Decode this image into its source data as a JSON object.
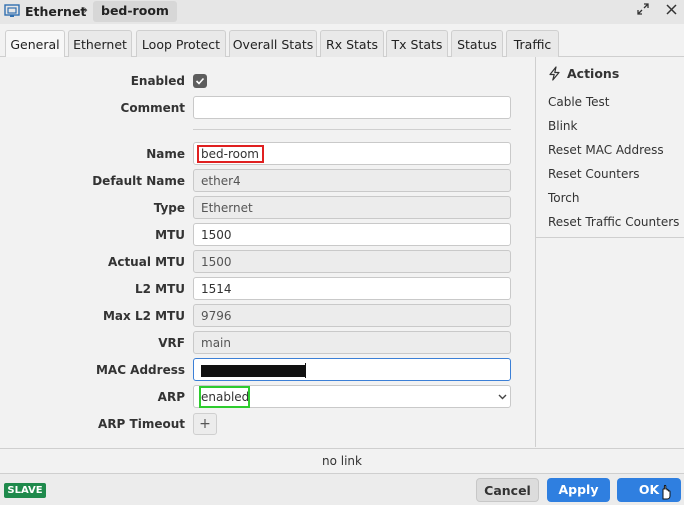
{
  "titlebar": {
    "section": "Ethernet",
    "separator": "›",
    "item": "bed-room",
    "icons": [
      "ethernet-port-icon",
      "expand-icon",
      "close-icon"
    ]
  },
  "tabs": [
    {
      "label": "General",
      "active": true
    },
    {
      "label": "Ethernet",
      "active": false
    },
    {
      "label": "Loop Protect",
      "active": false
    },
    {
      "label": "Overall Stats",
      "active": false
    },
    {
      "label": "Rx Stats",
      "active": false
    },
    {
      "label": "Tx Stats",
      "active": false
    },
    {
      "label": "Status",
      "active": false
    },
    {
      "label": "Traffic",
      "active": false
    }
  ],
  "form": {
    "enabled": {
      "label": "Enabled",
      "checked": true
    },
    "comment": {
      "label": "Comment",
      "value": ""
    },
    "name": {
      "label": "Name",
      "value": "bed-room"
    },
    "default_name": {
      "label": "Default Name",
      "value": "ether4"
    },
    "type": {
      "label": "Type",
      "value": "Ethernet"
    },
    "mtu": {
      "label": "MTU",
      "value": "1500"
    },
    "actual_mtu": {
      "label": "Actual MTU",
      "value": "1500"
    },
    "l2mtu": {
      "label": "L2 MTU",
      "value": "1514"
    },
    "max_l2mtu": {
      "label": "Max L2 MTU",
      "value": "9796"
    },
    "vrf": {
      "label": "VRF",
      "value": "main"
    },
    "mac_address": {
      "label": "MAC Address",
      "value": ""
    },
    "arp": {
      "label": "ARP",
      "value": "enabled"
    },
    "arp_timeout": {
      "label": "ARP Timeout",
      "add_label": "+"
    }
  },
  "actions": {
    "title": "Actions",
    "items": [
      "Cable Test",
      "Blink",
      "Reset MAC Address",
      "Reset Counters",
      "Torch",
      "Reset Traffic Counters"
    ]
  },
  "status": {
    "text": "no link"
  },
  "footer": {
    "badge": "SLAVE",
    "cancel_label": "Cancel",
    "apply_label": "Apply",
    "ok_label": "OK"
  },
  "colors": {
    "accent": "#2f7fe0",
    "badge": "#1f8a4c",
    "highlight_red": "#e02020",
    "highlight_green": "#2ecc2e"
  }
}
